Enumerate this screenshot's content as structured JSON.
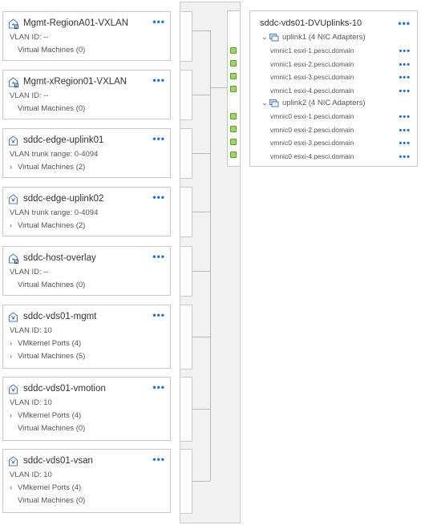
{
  "port_groups": [
    {
      "title": "Mgmt-RegionA01-VXLAN",
      "vlan": "VLAN ID: --",
      "vmkernel": null,
      "vms": "Virtual Machines (0)",
      "vms_expandable": false
    },
    {
      "title": "Mgmt-xRegion01-VXLAN",
      "vlan": "VLAN ID: --",
      "vmkernel": null,
      "vms": "Virtual Machines (0)",
      "vms_expandable": false
    },
    {
      "title": "sddc-edge-uplink01",
      "vlan": "VLAN trunk range: 0-4094",
      "vmkernel": null,
      "vms": "Virtual Machines (2)",
      "vms_expandable": true
    },
    {
      "title": "sddc-edge-uplink02",
      "vlan": "VLAN trunk range: 0-4094",
      "vmkernel": null,
      "vms": "Virtual Machines (2)",
      "vms_expandable": true
    },
    {
      "title": "sddc-host-overlay",
      "vlan": "VLAN ID: --",
      "vmkernel": null,
      "vms": "Virtual Machines (0)",
      "vms_expandable": false
    },
    {
      "title": "sddc-vds01-mgmt",
      "vlan": "VLAN ID: 10",
      "vmkernel": "VMkernel Ports (4)",
      "vms": "Virtual Machines (5)",
      "vms_expandable": true
    },
    {
      "title": "sddc-vds01-vmotion",
      "vlan": "VLAN ID: 10",
      "vmkernel": "VMkernel Ports (4)",
      "vms": "Virtual Machines (0)",
      "vms_expandable": false
    },
    {
      "title": "sddc-vds01-vsan",
      "vlan": "VLAN ID: 10",
      "vmkernel": "VMkernel Ports (4)",
      "vms": "Virtual Machines (0)",
      "vms_expandable": false
    }
  ],
  "more_glyph": "•••",
  "chevron_right": "›",
  "chevron_down": "⌄",
  "uplinks_panel": {
    "title": "sddc-vds01-DVUplinks-10",
    "groups": [
      {
        "label": "uplink1 (4 NIC Adapters)",
        "nics": [
          "vmnic1 esxi-1.pesci.domain",
          "vmnic1 esxi-2.pesci.domain",
          "vmnic1 esxi-3.pesci.domain",
          "vmnic1 esxi-4.pesci.domain"
        ]
      },
      {
        "label": "uplink2 (4 NIC Adapters)",
        "nics": [
          "vmnic0 esxi-1.pesci.domain",
          "vmnic0 esxi-2.pesci.domain",
          "vmnic0 esxi-3.pesci.domain",
          "vmnic0 esxi-4.pesci.domain"
        ]
      }
    ]
  },
  "colors": {
    "accent": "#2a6fb5",
    "port_green": "#9fd36b",
    "border": "#c9c9c9"
  }
}
